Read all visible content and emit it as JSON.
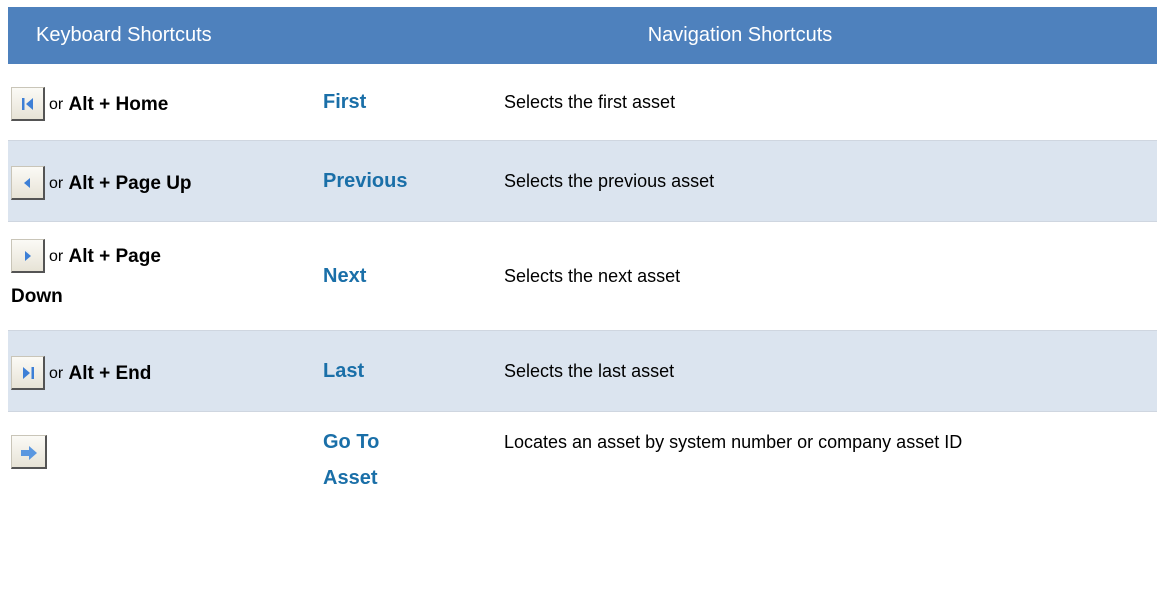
{
  "header": {
    "keyboard_label": "Keyboard Shortcuts",
    "navigation_label": "Navigation Shortcuts"
  },
  "rows": [
    {
      "icon": "first-icon",
      "or_text": "or",
      "keys": "Alt + Home",
      "command": "First",
      "description": "Selects the first asset"
    },
    {
      "icon": "previous-icon",
      "or_text": "or",
      "keys": "Alt + Page Up",
      "command": "Previous",
      "description": "Selects the previous asset"
    },
    {
      "icon": "next-icon",
      "or_text": "or",
      "keys_line1": "Alt + Page",
      "keys_line2": "Down",
      "command": "Next",
      "description": "Selects the next asset"
    },
    {
      "icon": "last-icon",
      "or_text": "or",
      "keys": "Alt + End",
      "command": "Last",
      "description": "Selects the last asset"
    },
    {
      "icon": "go-to-arrow-icon",
      "command_line1": "Go To",
      "command_line2": "Asset",
      "description": "Locates an asset by system number or company asset ID"
    }
  ],
  "colors": {
    "header_bg": "#4e81bd",
    "alt_row_bg": "#dbe4ef",
    "command_text": "#1a6fa8",
    "icon_blue": "#3d7fd6"
  }
}
